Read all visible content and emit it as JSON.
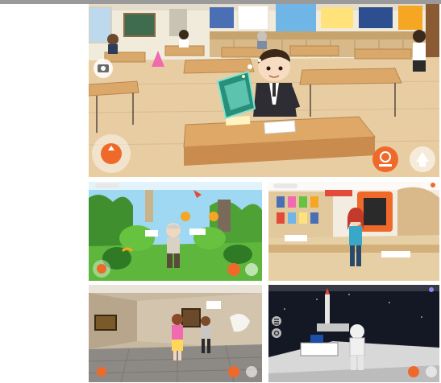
{
  "panels": [
    {
      "name": "virtual-classroom-main",
      "scene": "classroom"
    },
    {
      "name": "virtual-forest-scene",
      "scene": "forest"
    },
    {
      "name": "virtual-library-scene",
      "scene": "library"
    },
    {
      "name": "virtual-gallery-scene",
      "scene": "gallery"
    },
    {
      "name": "virtual-space-scene",
      "scene": "space"
    }
  ],
  "colors": {
    "action_orange": "#ef6a2a",
    "floor_wood": "#e9cfa6",
    "wall_cream": "#f3ede0",
    "forest_green": "#5fb63c",
    "space_dark": "#141824"
  },
  "icons": {
    "camera": "camera-icon",
    "joystick": "joystick-icon",
    "jump": "jump-icon",
    "action": "action-icon",
    "menu": "menu-icon",
    "settings": "gear-icon"
  }
}
